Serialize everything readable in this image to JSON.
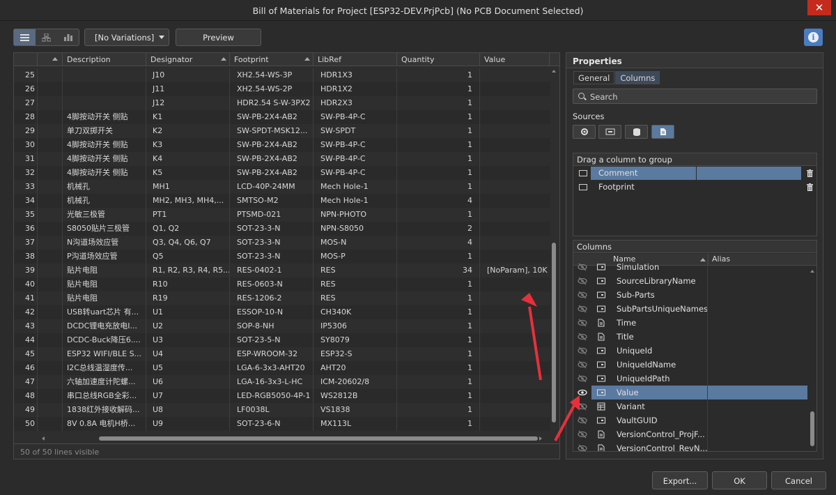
{
  "window": {
    "title": "Bill of Materials for Project [ESP32-DEV.PrjPcb] (No PCB Document Selected)",
    "close": "✕"
  },
  "toolbar": {
    "variation": "[No Variations]",
    "preview": "Preview"
  },
  "grid": {
    "columns": [
      "Description",
      "Designator",
      "Footprint",
      "LibRef",
      "Quantity",
      "Value"
    ],
    "rows": [
      {
        "n": "25",
        "d": "",
        "des": "J10",
        "fp": "XH2.54-WS-3P",
        "lib": "HDR1X3",
        "q": "1",
        "v": ""
      },
      {
        "n": "26",
        "d": "",
        "des": "J11",
        "fp": "XH2.54-WS-2P",
        "lib": "HDR1X2",
        "q": "1",
        "v": ""
      },
      {
        "n": "27",
        "d": "",
        "des": "J12",
        "fp": "HDR2.54 S-W-3PX2",
        "lib": "HDR2X3",
        "q": "1",
        "v": ""
      },
      {
        "n": "28",
        "d": "4脚按动开关 侧贴",
        "des": "K1",
        "fp": "SW-PB-2X4-AB2",
        "lib": "SW-PB-4P-C",
        "q": "1",
        "v": ""
      },
      {
        "n": "29",
        "d": "单刀双掷开关",
        "des": "K2",
        "fp": "SW-SPDT-MSK12...",
        "lib": "SW-SPDT",
        "q": "1",
        "v": ""
      },
      {
        "n": "30",
        "d": "4脚按动开关 侧贴",
        "des": "K3",
        "fp": "SW-PB-2X4-AB2",
        "lib": "SW-PB-4P-C",
        "q": "1",
        "v": ""
      },
      {
        "n": "31",
        "d": "4脚按动开关 侧贴",
        "des": "K4",
        "fp": "SW-PB-2X4-AB2",
        "lib": "SW-PB-4P-C",
        "q": "1",
        "v": ""
      },
      {
        "n": "32",
        "d": "4脚按动开关 侧贴",
        "des": "K5",
        "fp": "SW-PB-2X4-AB2",
        "lib": "SW-PB-4P-C",
        "q": "1",
        "v": ""
      },
      {
        "n": "33",
        "d": "机械孔",
        "des": "MH1",
        "fp": "LCD-40P-24MM",
        "lib": "Mech Hole-1",
        "q": "1",
        "v": ""
      },
      {
        "n": "34",
        "d": "机械孔",
        "des": "MH2, MH3, MH4,...",
        "fp": "SMTSO-M2",
        "lib": "Mech Hole-1",
        "q": "4",
        "v": ""
      },
      {
        "n": "35",
        "d": "光敏三极管",
        "des": "PT1",
        "fp": "PTSMD-021",
        "lib": "NPN-PHOTO",
        "q": "1",
        "v": ""
      },
      {
        "n": "36",
        "d": "S8050贴片三极管",
        "des": "Q1, Q2",
        "fp": "SOT-23-3-N",
        "lib": "NPN-S8050",
        "q": "2",
        "v": ""
      },
      {
        "n": "37",
        "d": "N沟道场效应管",
        "des": "Q3, Q4, Q6, Q7",
        "fp": "SOT-23-3-N",
        "lib": "MOS-N",
        "q": "4",
        "v": ""
      },
      {
        "n": "38",
        "d": "P沟道场效应管",
        "des": "Q5",
        "fp": "SOT-23-3-N",
        "lib": "MOS-P",
        "q": "1",
        "v": ""
      },
      {
        "n": "39",
        "d": "贴片电阻",
        "des": "R1, R2, R3, R4, R5...",
        "fp": "RES-0402-1",
        "lib": "RES",
        "q": "34",
        "v": "[NoParam], 10K"
      },
      {
        "n": "40",
        "d": "贴片电阻",
        "des": "R10",
        "fp": "RES-0603-N",
        "lib": "RES",
        "q": "1",
        "v": ""
      },
      {
        "n": "41",
        "d": "贴片电阻",
        "des": "R19",
        "fp": "RES-1206-2",
        "lib": "RES",
        "q": "1",
        "v": ""
      },
      {
        "n": "42",
        "d": "USB转uart芯片 有...",
        "des": "U1",
        "fp": "ESSOP-10-N",
        "lib": "CH340K",
        "q": "1",
        "v": ""
      },
      {
        "n": "43",
        "d": "DCDC锂电充放电I...",
        "des": "U2",
        "fp": "SOP-8-NH",
        "lib": "IP5306",
        "q": "1",
        "v": ""
      },
      {
        "n": "44",
        "d": "DCDC-Buck降压6....",
        "des": "U3",
        "fp": "SOT-23-5-N",
        "lib": "SY8079",
        "q": "1",
        "v": ""
      },
      {
        "n": "45",
        "d": "ESP32 WIFI/BLE S...",
        "des": "U4",
        "fp": "ESP-WROOM-32",
        "lib": "ESP32-S",
        "q": "1",
        "v": ""
      },
      {
        "n": "46",
        "d": "I2C总线温湿度传...",
        "des": "U5",
        "fp": "LGA-6-3x3-AHT20",
        "lib": "AHT20",
        "q": "1",
        "v": ""
      },
      {
        "n": "47",
        "d": "六轴加速度计陀螺...",
        "des": "U6",
        "fp": "LGA-16-3x3-L-HC",
        "lib": "ICM-20602/8",
        "q": "1",
        "v": ""
      },
      {
        "n": "48",
        "d": "串口总线RGB全彩...",
        "des": "U7",
        "fp": "LED-RGB5050-4P-1",
        "lib": "WS2812B",
        "q": "1",
        "v": ""
      },
      {
        "n": "49",
        "d": "1838红外接收解码...",
        "des": "U8",
        "fp": "LF0038L",
        "lib": "VS1838",
        "q": "1",
        "v": ""
      },
      {
        "n": "50",
        "d": "8V 0.8A 电机H桥...",
        "des": "U9",
        "fp": "SOT-23-6-N",
        "lib": "MX113L",
        "q": "1",
        "v": ""
      }
    ],
    "footer": "50 of 50 lines visible"
  },
  "properties": {
    "title": "Properties",
    "tabs": [
      "General",
      "Columns"
    ],
    "search_placeholder": "Search",
    "sources_label": "Sources",
    "group_header": "Drag a column to group",
    "group_items": [
      "Comment",
      "Footprint"
    ],
    "columns_header": "Columns",
    "col_headers": [
      "Name",
      "Alias"
    ],
    "columns": [
      {
        "name": "Simulation",
        "visible": false,
        "icon": "param"
      },
      {
        "name": "SourceLibraryName",
        "visible": false,
        "icon": "param"
      },
      {
        "name": "Sub-Parts",
        "visible": false,
        "icon": "param"
      },
      {
        "name": "SubPartsUniqueNames",
        "visible": false,
        "icon": "param"
      },
      {
        "name": "Time",
        "visible": false,
        "icon": "doc"
      },
      {
        "name": "Title",
        "visible": false,
        "icon": "doc"
      },
      {
        "name": "UniqueId",
        "visible": false,
        "icon": "param"
      },
      {
        "name": "UniqueIdName",
        "visible": false,
        "icon": "param"
      },
      {
        "name": "UniqueIdPath",
        "visible": false,
        "icon": "param"
      },
      {
        "name": "Value",
        "visible": true,
        "icon": "param"
      },
      {
        "name": "Variant",
        "visible": false,
        "icon": "table"
      },
      {
        "name": "VaultGUID",
        "visible": false,
        "icon": "param"
      },
      {
        "name": "VersionControl_ProjF...",
        "visible": false,
        "icon": "doc"
      },
      {
        "name": "VersionControl_RevN...",
        "visible": false,
        "icon": "doc"
      }
    ]
  },
  "buttons": {
    "export": "Export...",
    "ok": "OK",
    "cancel": "Cancel"
  },
  "colors": {
    "accent": "#5a7aa0",
    "annotation_arrow": "#e8303a"
  }
}
